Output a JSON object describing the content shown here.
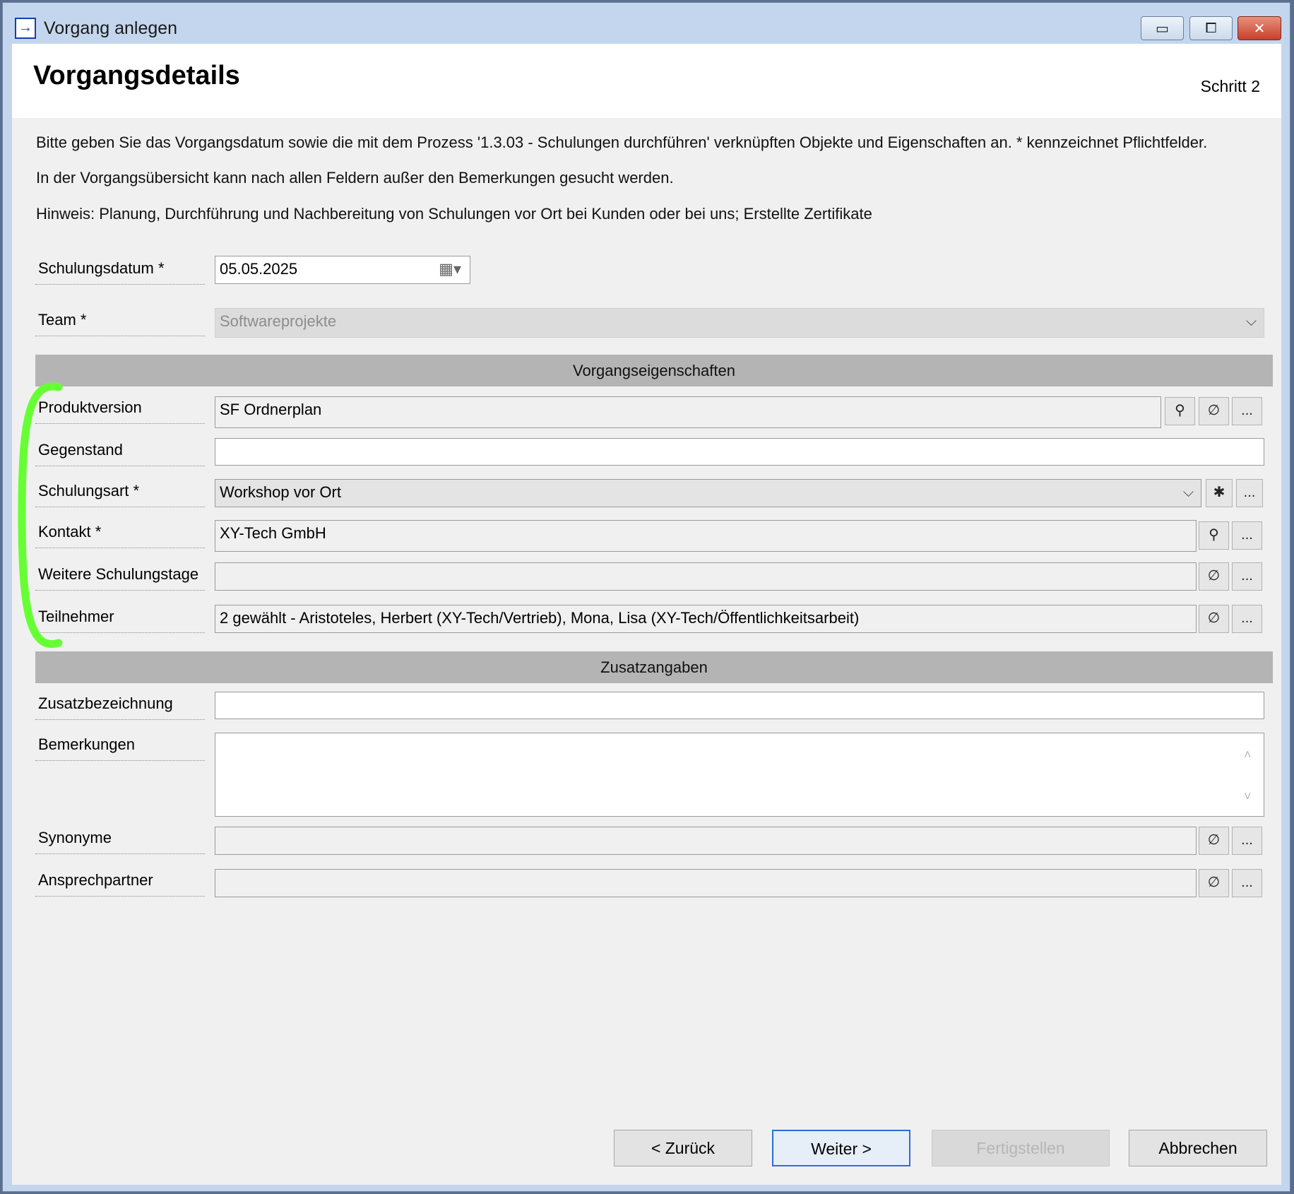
{
  "window": {
    "title": "Vorgang anlegen",
    "controls": {
      "minimize": "▭",
      "maximize": "⧠",
      "close": "✕"
    }
  },
  "header": {
    "title": "Vorgangsdetails",
    "step": "Schritt 2"
  },
  "description": {
    "line1": "Bitte geben Sie das Vorgangsdatum sowie die mit dem Prozess '1.3.03 - Schulungen durchführen' verknüpften Objekte und Eigenschaften an. * kennzeichnet Pflichtfelder.",
    "line2": "In der Vorgangsübersicht kann nach allen Feldern außer den Bemerkungen gesucht werden.",
    "line3": "Hinweis: Planung, Durchführung und Nachbereitung von Schulungen vor Ort bei Kunden oder bei uns; Erstellte Zertifikate"
  },
  "fields": {
    "schulungsdatum": {
      "label": "Schulungsdatum *",
      "value": "05.05.2025"
    },
    "team": {
      "label": "Team *",
      "value": "Softwareprojekte"
    }
  },
  "sections": {
    "vorgangseigenschaften": "Vorgangseigenschaften",
    "zusatzangaben": "Zusatzangaben"
  },
  "properties": {
    "produktversion": {
      "label": "Produktversion",
      "value": "SF Ordnerplan"
    },
    "gegenstand": {
      "label": "Gegenstand",
      "value": ""
    },
    "schulungsart": {
      "label": "Schulungsart *",
      "value": "Workshop vor Ort"
    },
    "kontakt": {
      "label": "Kontakt *",
      "value": "XY-Tech GmbH"
    },
    "weitere_schulungstage": {
      "label": "Weitere Schulungstage",
      "value": ""
    },
    "teilnehmer": {
      "label": "Teilnehmer",
      "value": "2 gewählt - Aristoteles, Herbert (XY-Tech/Vertrieb), Mona, Lisa (XY-Tech/Öffentlichkeitsarbeit)"
    }
  },
  "extra": {
    "zusatzbezeichnung": {
      "label": "Zusatzbezeichnung",
      "value": ""
    },
    "bemerkungen": {
      "label": "Bemerkungen",
      "value": ""
    },
    "synonyme": {
      "label": "Synonyme",
      "value": ""
    },
    "ansprechpartner": {
      "label": "Ansprechpartner",
      "value": ""
    }
  },
  "icons": {
    "pin": "⚲",
    "clear": "∅",
    "more": "...",
    "new": "✱",
    "chevron": "⌵",
    "calendar": "▦",
    "scroll_up": "˄",
    "scroll_down": "˅"
  },
  "buttons": {
    "back": "< Zurück",
    "next": "Weiter >",
    "finish": "Fertigstellen",
    "cancel": "Abbrechen"
  },
  "colors": {
    "annotation_bracket": "#66ff33",
    "primary_button_border": "#2b6fd8"
  }
}
